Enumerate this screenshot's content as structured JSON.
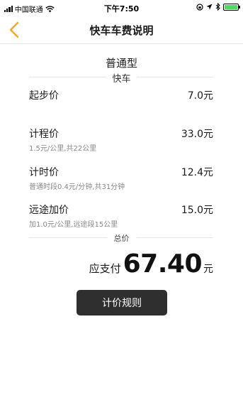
{
  "status_bar": {
    "carrier": "中国联通",
    "time": "下午7:50",
    "icons": [
      "signal-icon",
      "wifi-icon",
      "lock-rotation-icon",
      "location-icon",
      "bluetooth-icon",
      "battery-icon"
    ],
    "battery_color": "#4cd964"
  },
  "nav": {
    "title": "快车车费说明",
    "back_icon": "chevron-left-icon",
    "accent_color": "#f5a623"
  },
  "car_type": "普通型",
  "section_label": "快车",
  "fees": [
    {
      "name": "起步价",
      "value": "7.0元",
      "detail": ""
    },
    {
      "name": "计程价",
      "value": "33.0元",
      "detail": "1.5元/公里,共22公里"
    },
    {
      "name": "计时价",
      "value": "12.4元",
      "detail": "普通时段0.4元/分钟,共31分钟"
    },
    {
      "name": "远途加价",
      "value": "15.0元",
      "detail": "加1.0元/公里,远途段15公里"
    }
  ],
  "total": {
    "label": "总价",
    "prefix": "应支付",
    "amount": "67.40",
    "unit": "元"
  },
  "rules_button": "计价规则"
}
